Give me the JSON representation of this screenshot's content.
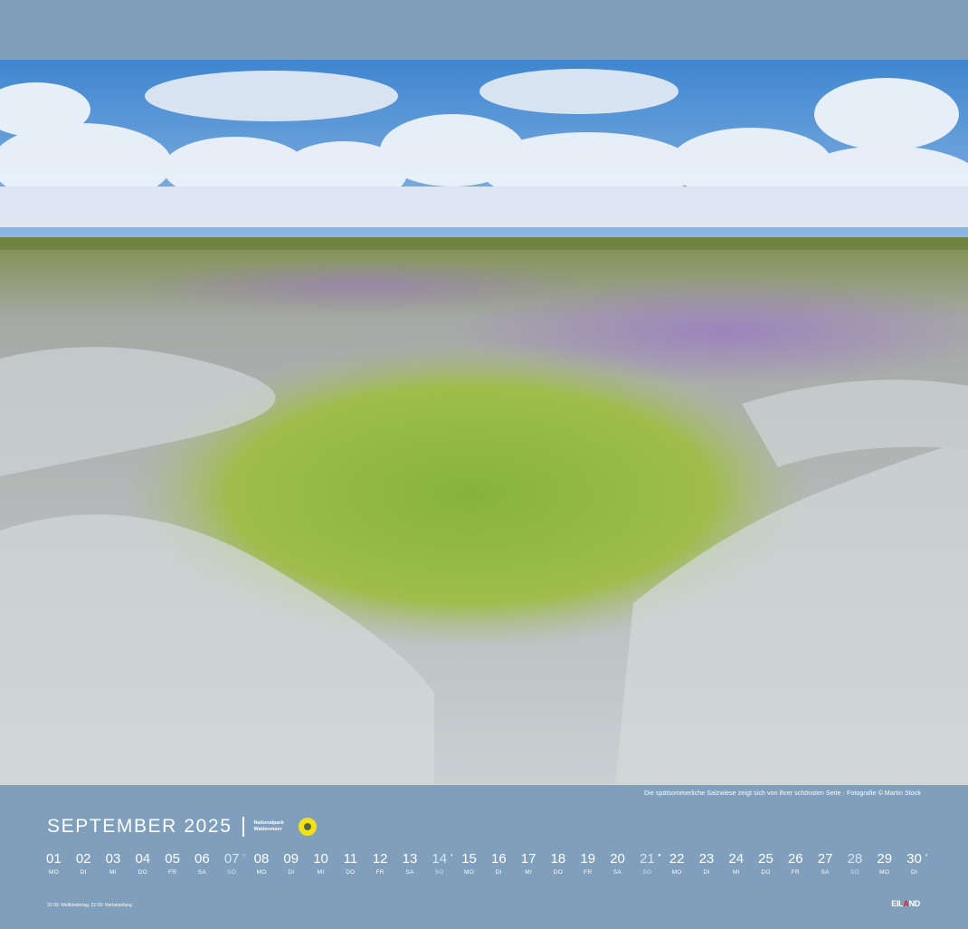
{
  "photo": {
    "description_caption": "Die spätsommerliche Salzwiese zeigt sich von ihrer schönsten Seite · Fotografie © Martin Stock"
  },
  "header": {
    "month_title": "SEPTEMBER 2025",
    "park_label_line1": "Nationalpark",
    "park_label_line2": "Wattenmeer"
  },
  "days": [
    {
      "num": "01",
      "wd": "MO",
      "sunday": false,
      "moon": ""
    },
    {
      "num": "02",
      "wd": "DI",
      "sunday": false,
      "moon": ""
    },
    {
      "num": "03",
      "wd": "MI",
      "sunday": false,
      "moon": ""
    },
    {
      "num": "04",
      "wd": "DO",
      "sunday": false,
      "moon": ""
    },
    {
      "num": "05",
      "wd": "FR",
      "sunday": false,
      "moon": ""
    },
    {
      "num": "06",
      "wd": "SA",
      "sunday": false,
      "moon": ""
    },
    {
      "num": "07",
      "wd": "SO",
      "sunday": true,
      "moon": "○"
    },
    {
      "num": "08",
      "wd": "MO",
      "sunday": false,
      "moon": ""
    },
    {
      "num": "09",
      "wd": "DI",
      "sunday": false,
      "moon": ""
    },
    {
      "num": "10",
      "wd": "MI",
      "sunday": false,
      "moon": ""
    },
    {
      "num": "11",
      "wd": "DO",
      "sunday": false,
      "moon": ""
    },
    {
      "num": "12",
      "wd": "FR",
      "sunday": false,
      "moon": ""
    },
    {
      "num": "13",
      "wd": "SA",
      "sunday": false,
      "moon": ""
    },
    {
      "num": "14",
      "wd": "SO",
      "sunday": true,
      "moon": "◖"
    },
    {
      "num": "15",
      "wd": "MO",
      "sunday": false,
      "moon": ""
    },
    {
      "num": "16",
      "wd": "DI",
      "sunday": false,
      "moon": ""
    },
    {
      "num": "17",
      "wd": "MI",
      "sunday": false,
      "moon": ""
    },
    {
      "num": "18",
      "wd": "DO",
      "sunday": false,
      "moon": ""
    },
    {
      "num": "19",
      "wd": "FR",
      "sunday": false,
      "moon": ""
    },
    {
      "num": "20",
      "wd": "SA",
      "sunday": false,
      "moon": ""
    },
    {
      "num": "21",
      "wd": "SO",
      "sunday": true,
      "moon": "●"
    },
    {
      "num": "22",
      "wd": "MO",
      "sunday": false,
      "moon": ""
    },
    {
      "num": "23",
      "wd": "DI",
      "sunday": false,
      "moon": ""
    },
    {
      "num": "24",
      "wd": "MI",
      "sunday": false,
      "moon": ""
    },
    {
      "num": "25",
      "wd": "DO",
      "sunday": false,
      "moon": ""
    },
    {
      "num": "26",
      "wd": "FR",
      "sunday": false,
      "moon": ""
    },
    {
      "num": "27",
      "wd": "SA",
      "sunday": false,
      "moon": ""
    },
    {
      "num": "28",
      "wd": "SO",
      "sunday": true,
      "moon": ""
    },
    {
      "num": "29",
      "wd": "MO",
      "sunday": false,
      "moon": ""
    },
    {
      "num": "30",
      "wd": "DI",
      "sunday": false,
      "moon": "◗"
    }
  ],
  "footnote": "20.09. Weltkindertag, 22.09. Herbstanfang",
  "brand": {
    "part1": "EIL",
    "part2": "A",
    "part3": "ND"
  },
  "colors": {
    "frame_blue": "#7f9fbc",
    "sunday_text": "#d6e6f5",
    "logo_yellow": "#f3e21a",
    "brand_red": "#d8232a"
  }
}
